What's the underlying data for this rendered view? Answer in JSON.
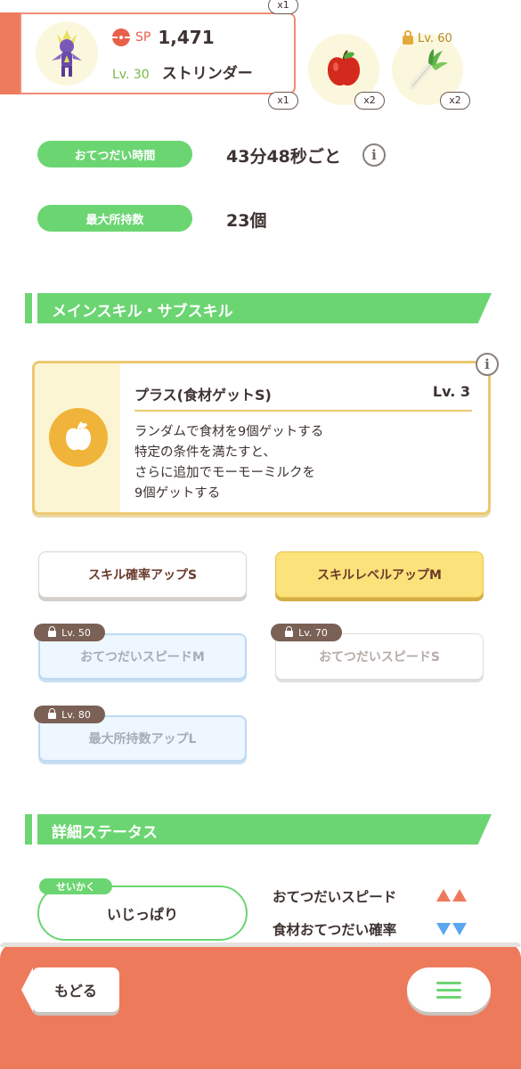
{
  "header": {
    "sp_label": "SP",
    "sp_value": "1,471",
    "level": "Lv. 30",
    "name": "ストリンダー"
  },
  "ingredients": [
    {
      "name": "apple-icon",
      "count_top": "x1",
      "count_bottom": "x1"
    },
    {
      "name": "apple-icon",
      "count": "x2"
    },
    {
      "name": "leek-icon",
      "count": "x2",
      "unlock_level": "Lv. 60"
    }
  ],
  "stats": {
    "help_time_label": "おてつだい時間",
    "help_time_value": "43分48秒ごと",
    "max_carry_label": "最大所持数",
    "max_carry_value": "23個"
  },
  "sections": {
    "skills_title": "メインスキル・サブスキル",
    "details_title": "詳細ステータス"
  },
  "main_skill": {
    "name": "プラス(食材ゲットS)",
    "level": "Lv. 3",
    "desc_lines": [
      "ランダムで食材を9個ゲットする",
      "特定の条件を満たすと、",
      "さらに追加でモーモーミルクを",
      "9個ゲットする"
    ]
  },
  "sub_skills": [
    {
      "label": "スキル確率アップS",
      "lock": ""
    },
    {
      "label": "スキルレベルアップM",
      "lock": ""
    },
    {
      "label": "おてつだいスピードM",
      "lock": "Lv. 50"
    },
    {
      "label": "おてつだいスピードS",
      "lock": "Lv. 70"
    },
    {
      "label": "最大所持数アップL",
      "lock": "Lv. 80"
    }
  ],
  "nature": {
    "tag": "せいかく",
    "value": "いじっぱり",
    "effects": [
      {
        "label": "おてつだいスピード",
        "direction": "up"
      },
      {
        "label": "食材おてつだい確率",
        "direction": "down"
      }
    ]
  },
  "nav": {
    "back_label": "もどる"
  },
  "colors": {
    "accent": "#ee7a5c",
    "green": "#6bd572",
    "gold": "#fbe27a",
    "up": "#ee7a5c",
    "down": "#5aa6f0"
  }
}
